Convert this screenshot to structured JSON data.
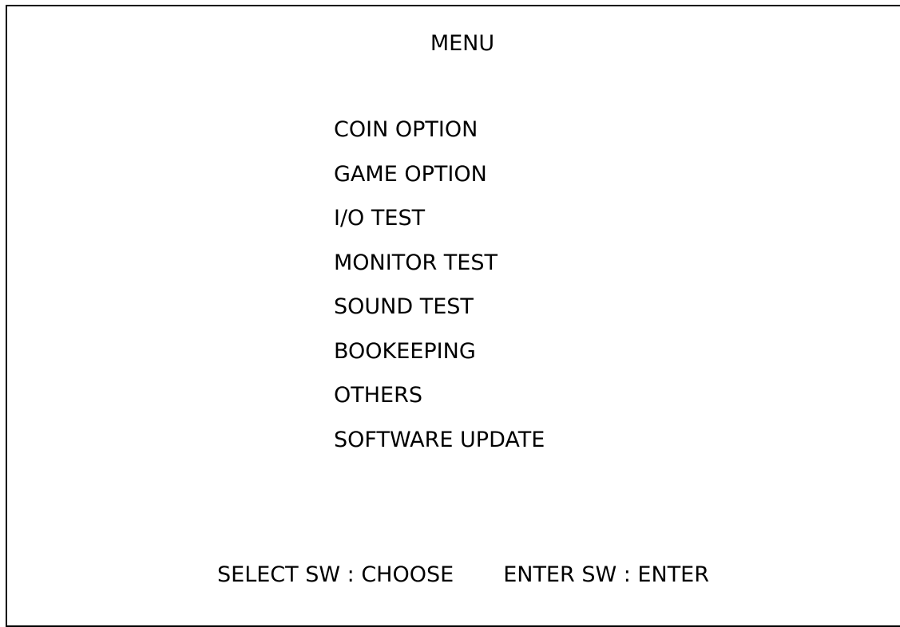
{
  "screen": {
    "title": "MENU"
  },
  "menu": {
    "items": [
      {
        "label": "COIN OPTION"
      },
      {
        "label": "GAME OPTION"
      },
      {
        "label": "I/O TEST"
      },
      {
        "label": "MONITOR TEST"
      },
      {
        "label": "SOUND TEST"
      },
      {
        "label": "BOOKEEPING"
      },
      {
        "label": "OTHERS"
      },
      {
        "label": "SOFTWARE UPDATE"
      }
    ]
  },
  "footer": {
    "select_hint": "SELECT SW : CHOOSE",
    "enter_hint": "ENTER SW : ENTER"
  }
}
